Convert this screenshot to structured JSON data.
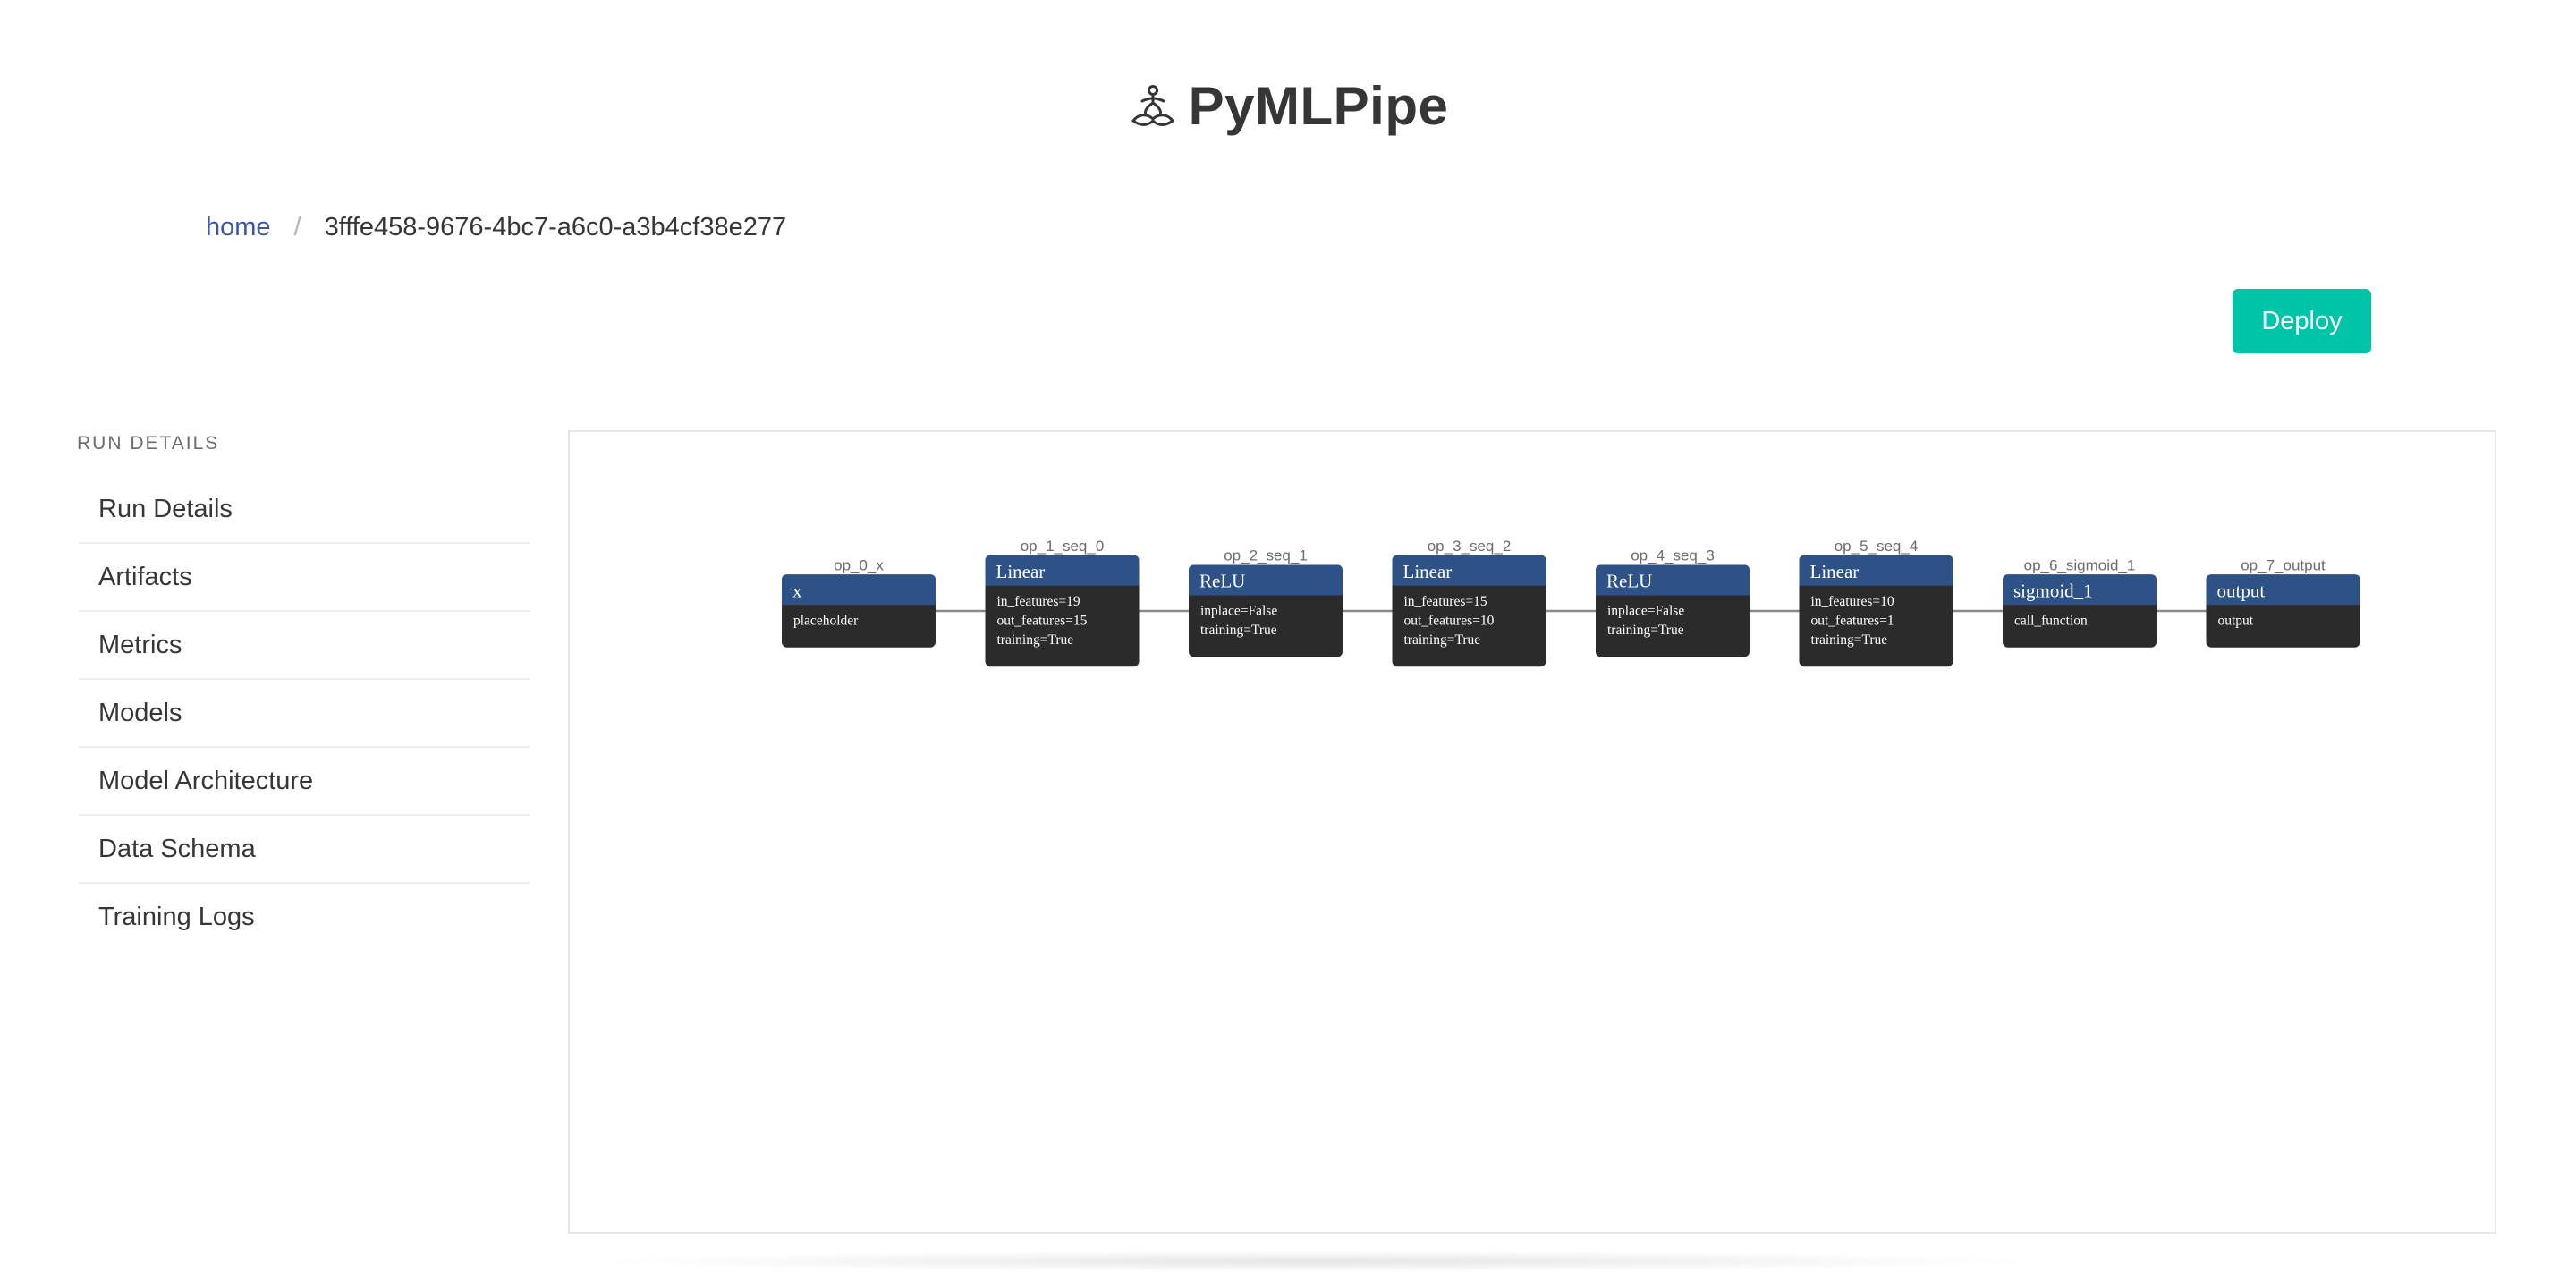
{
  "brand": {
    "title": "PyMLPipe",
    "icon": "meditating-figure-icon"
  },
  "breadcrumb": {
    "home": "home",
    "separator": "/",
    "current": "3fffe458-9676-4bc7-a6c0-a3b4cf38e277"
  },
  "actions": {
    "deploy_label": "Deploy"
  },
  "menu": {
    "label": "RUN DETAILS",
    "items": [
      {
        "label": "Run Details"
      },
      {
        "label": "Artifacts"
      },
      {
        "label": "Metrics"
      },
      {
        "label": "Models"
      },
      {
        "label": "Model Architecture"
      },
      {
        "label": "Data Schema"
      },
      {
        "label": "Training Logs"
      }
    ]
  },
  "colors": {
    "accent": "#00c4a7",
    "link": "#3e56a0",
    "node_header": "#2f5286",
    "node_body": "#2b2b2b",
    "edge": "#8a8a8a"
  },
  "graph": {
    "nodes": [
      {
        "id": "op_0_x",
        "title": "x",
        "lines": [
          "placeholder"
        ]
      },
      {
        "id": "op_1_seq_0",
        "title": "Linear",
        "lines": [
          "in_features=19",
          "out_features=15",
          "training=True"
        ]
      },
      {
        "id": "op_2_seq_1",
        "title": "ReLU",
        "lines": [
          "inplace=False",
          "training=True"
        ]
      },
      {
        "id": "op_3_seq_2",
        "title": "Linear",
        "lines": [
          "in_features=15",
          "out_features=10",
          "training=True"
        ]
      },
      {
        "id": "op_4_seq_3",
        "title": "ReLU",
        "lines": [
          "inplace=False",
          "training=True"
        ]
      },
      {
        "id": "op_5_seq_4",
        "title": "Linear",
        "lines": [
          "in_features=10",
          "out_features=1",
          "training=True"
        ]
      },
      {
        "id": "op_6_sigmoid_1",
        "title": "sigmoid_1",
        "lines": [
          "call_function"
        ]
      },
      {
        "id": "op_7_output",
        "title": "output",
        "lines": [
          "output"
        ]
      }
    ]
  }
}
